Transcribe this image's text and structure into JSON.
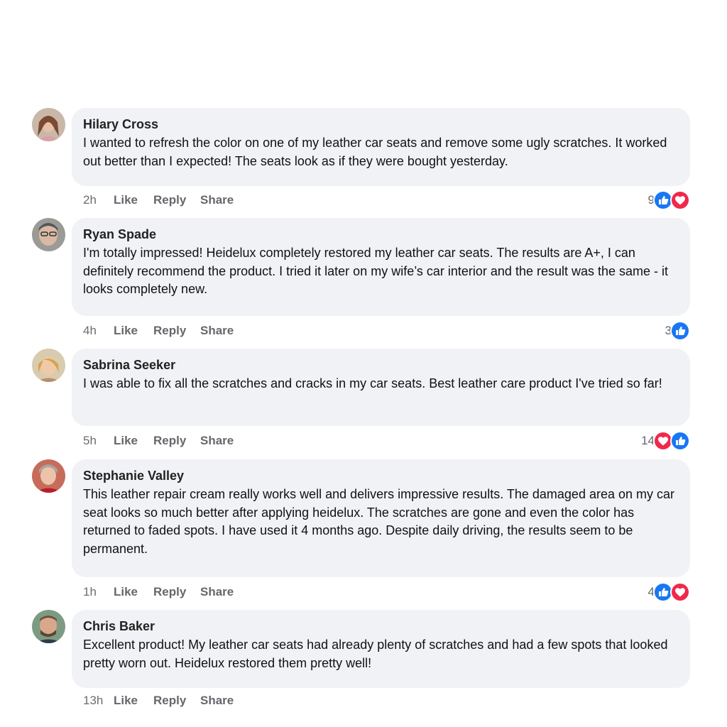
{
  "comments": [
    {
      "author": "Hilary Cross",
      "text": "I wanted to refresh the color on one of my leather car seats and remove some ugly scratches. It worked out better than I expected! The seats look as if they were bought yesterday.",
      "time": "2h",
      "like": "Like",
      "reply": "Reply",
      "share": "Share",
      "reaction_count": "9",
      "reactions": [
        "like-icon",
        "love-icon"
      ]
    },
    {
      "author": "Ryan Spade",
      "text": "I'm totally impressed! Heidelux completely restored my leather car seats. The results are A+, I can definitely recommend the product. I tried it later on my wife’s car interior and the result was the same - it looks completely new.",
      "time": "4h",
      "like": "Like",
      "reply": "Reply",
      "share": "Share",
      "reaction_count": "3",
      "reactions": [
        "like-icon"
      ]
    },
    {
      "author": "Sabrina Seeker",
      "text": "I was able to fix all the scratches and cracks in my car seats. Best leather care product I've tried so far!",
      "time": "5h",
      "like": "Like",
      "reply": "Reply",
      "share": "Share",
      "reaction_count": "14",
      "reactions": [
        "love-icon",
        "like-icon"
      ]
    },
    {
      "author": "Stephanie Valley",
      "text": "This leather repair cream really works well and delivers impressive results. The damaged area on my car seat looks so much better after applying heidelux. The scratches are gone and even the color has returned to faded spots. I have used it 4 months ago. Despite daily driving, the results seem to be permanent.",
      "time": "1h",
      "like": "Like",
      "reply": "Reply",
      "share": "Share",
      "reaction_count": "4",
      "reactions": [
        "like-icon",
        "love-icon"
      ]
    },
    {
      "author": "Chris Baker",
      "text": "Excellent product! My leather car seats had already plenty of scratches and had a few spots that looked pretty worn out. Heidelux restored them pretty well!",
      "time": "13h",
      "like": "Like",
      "reply": "Reply",
      "share": "Share",
      "reaction_count": "",
      "reactions": []
    }
  ],
  "colors": {
    "like_blue": "#1877f2",
    "love_red": "#f0284a",
    "bubble_bg": "#f0f2f5"
  }
}
